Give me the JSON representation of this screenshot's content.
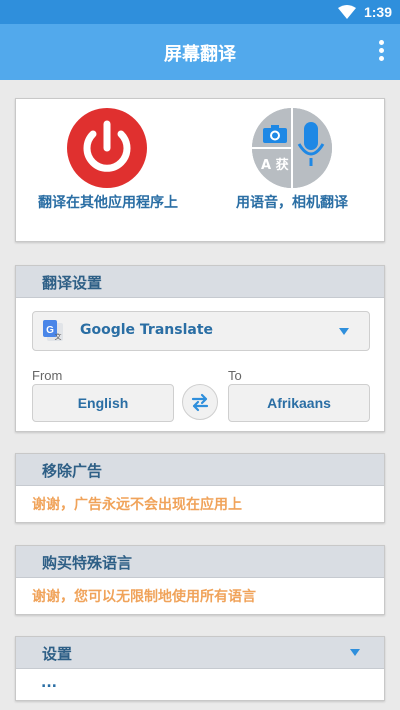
{
  "status_bar": {
    "time": "1:39"
  },
  "app_bar": {
    "title": "屏幕翻译"
  },
  "features": {
    "screen_translate_label": "翻译在其他应用程序上",
    "voice_camera_label": "用语音，相机翻译",
    "voice_icon_text": "A 获"
  },
  "translation_settings": {
    "header": "翻译设置",
    "engine": "Google Translate",
    "from_label": "From",
    "to_label": "To",
    "from_language": "English",
    "to_language": "Afrikaans"
  },
  "remove_ads": {
    "header": "移除广告",
    "message": "谢谢，广告永远不会出现在应用上"
  },
  "buy_languages": {
    "header": "购买特殊语言",
    "message": "谢谢，您可以无限制地使用所有语言"
  },
  "settings": {
    "header": "设置",
    "content": "..."
  },
  "colors": {
    "app_bar": "#52a9ec",
    "status_bar": "#2f8fdc",
    "accent_text": "#2a6ea4",
    "power_red": "#e0302f",
    "thanks_orange": "#f0a35a"
  }
}
